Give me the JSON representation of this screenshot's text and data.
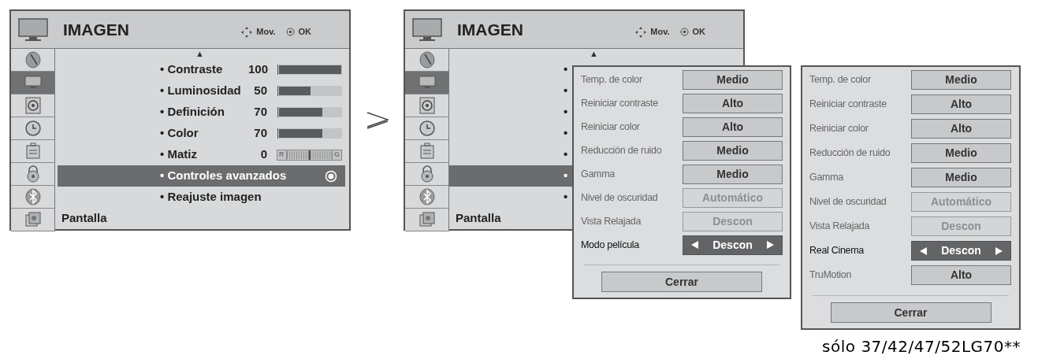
{
  "menus": [
    {
      "header": {
        "title": "IMAGEN",
        "move_hint": "Mov.",
        "ok_hint": "OK"
      },
      "sidebar": [
        {
          "selected": false
        },
        {
          "selected": true
        },
        {
          "selected": false
        },
        {
          "selected": false
        },
        {
          "selected": false
        },
        {
          "selected": false
        },
        {
          "selected": false
        },
        {
          "selected": false
        }
      ],
      "scroll_up": "▲",
      "items": [
        {
          "kind": "slider",
          "label": "• Contraste",
          "value": "100",
          "level": 1,
          "selected": false
        },
        {
          "kind": "slider",
          "label": "• Luminosidad",
          "value": "50",
          "level": 0.5,
          "selected": false
        },
        {
          "kind": "slider",
          "label": "• Definición",
          "value": "70",
          "level": 0.7,
          "selected": false
        },
        {
          "kind": "slider",
          "label": "• Color",
          "value": "70",
          "level": 0.7,
          "selected": false
        },
        {
          "kind": "tint",
          "label": "• Matiz",
          "value": "0",
          "left_label": "R",
          "right_label": "G",
          "selected": false
        },
        {
          "kind": "submenu",
          "label": "• Controles avanzados",
          "selected": true
        },
        {
          "kind": "plain",
          "label": "• Reajuste imagen",
          "selected": false
        }
      ],
      "footer": "Pantalla"
    },
    {
      "header": {
        "title": "IMAGEN",
        "move_hint": "Mov.",
        "ok_hint": "OK"
      },
      "sidebar": [
        {
          "selected": false
        },
        {
          "selected": true
        },
        {
          "selected": false
        },
        {
          "selected": false
        },
        {
          "selected": false
        },
        {
          "selected": false
        },
        {
          "selected": false
        },
        {
          "selected": false
        }
      ],
      "scroll_up": "▲",
      "items": [
        {
          "kind": "bullet",
          "label": "•",
          "selected": false
        },
        {
          "kind": "bullet",
          "label": "•",
          "selected": false
        },
        {
          "kind": "bullet",
          "label": "•",
          "selected": false
        },
        {
          "kind": "bullet",
          "label": "•",
          "selected": false
        },
        {
          "kind": "bullet",
          "label": "•",
          "selected": false
        },
        {
          "kind": "bullet",
          "label": "•",
          "selected": true
        },
        {
          "kind": "bullet",
          "label": "•",
          "selected": false
        }
      ],
      "footer": "Pantalla"
    }
  ],
  "popups": [
    {
      "rows": [
        {
          "label": "Temp. de color",
          "value": "Medio",
          "disabled": false,
          "selected": false
        },
        {
          "label": "Reiniciar contraste",
          "value": "Alto",
          "disabled": false,
          "selected": false
        },
        {
          "label": "Reiniciar color",
          "value": "Alto",
          "disabled": false,
          "selected": false
        },
        {
          "label": "Reducción de ruido",
          "value": "Medio",
          "disabled": false,
          "selected": false
        },
        {
          "label": "Gamma",
          "value": "Medio",
          "disabled": false,
          "selected": false
        },
        {
          "label": "Nivel de oscuridad",
          "value": "Automático",
          "disabled": true,
          "selected": false
        },
        {
          "label": "Vista Relajada",
          "value": "Descon",
          "disabled": true,
          "selected": false
        },
        {
          "label": "Modo película",
          "value": "Descon",
          "disabled": false,
          "selected": true
        }
      ],
      "close_button": "Cerrar"
    },
    {
      "rows": [
        {
          "label": "Temp. de color",
          "value": "Medio",
          "disabled": false,
          "selected": false
        },
        {
          "label": "Reiniciar contraste",
          "value": "Alto",
          "disabled": false,
          "selected": false
        },
        {
          "label": "Reiniciar color",
          "value": "Alto",
          "disabled": false,
          "selected": false
        },
        {
          "label": "Reducción de ruido",
          "value": "Medio",
          "disabled": false,
          "selected": false
        },
        {
          "label": "Gamma",
          "value": "Medio",
          "disabled": false,
          "selected": false
        },
        {
          "label": "Nivel de oscuridad",
          "value": "Automático",
          "disabled": true,
          "selected": false
        },
        {
          "label": "Vista Relajada",
          "value": "Descon",
          "disabled": true,
          "selected": false
        },
        {
          "label": "Real Cinema",
          "value": "Descon",
          "disabled": false,
          "selected": true
        },
        {
          "label": "TruMotion",
          "value": "Alto",
          "disabled": false,
          "selected": false
        }
      ],
      "close_button": "Cerrar"
    }
  ],
  "note": "sólo 37/42/47/52LG70**"
}
